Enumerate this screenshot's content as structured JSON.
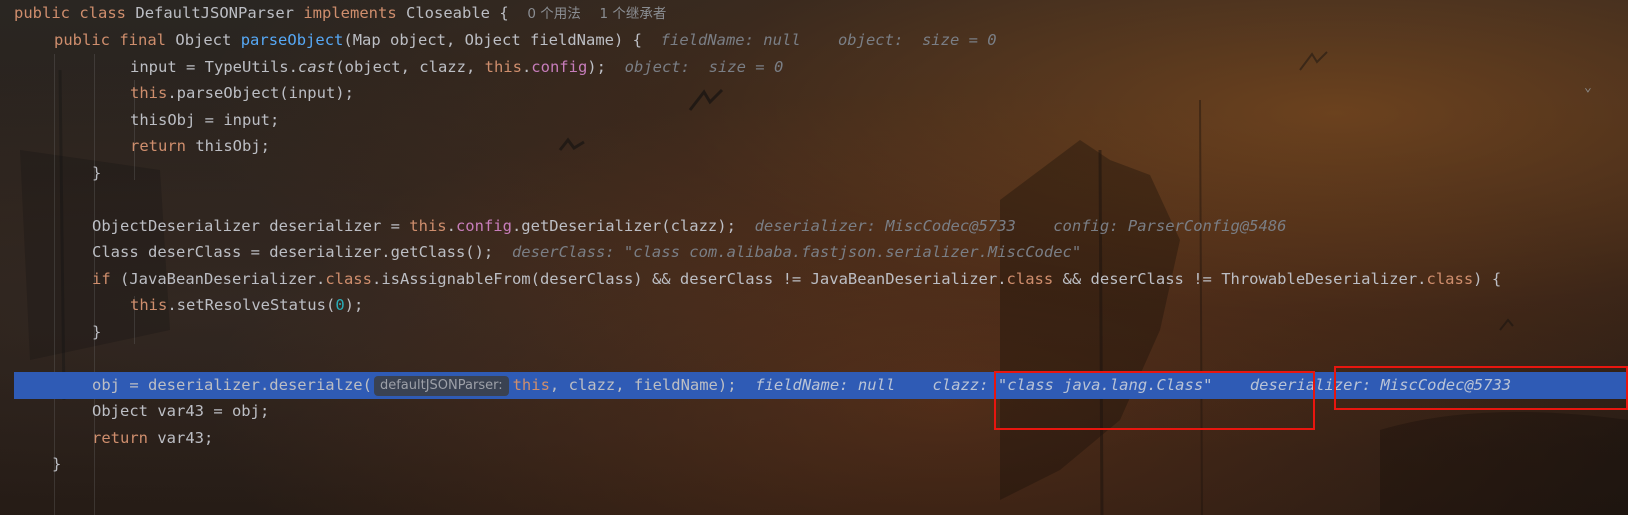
{
  "line1": {
    "kw1": "public",
    "kw2": "class",
    "class_name": "DefaultJSONParser",
    "kw3": "implements",
    "iface": "Closeable",
    "brace": "{",
    "usages": "0 个用法",
    "inheritors": "1 个继承者"
  },
  "line2": {
    "kw1": "public",
    "kw2": "final",
    "t1": "Object",
    "method": "parseObject",
    "params": "(Map object, Object fieldName) {",
    "hint1": "fieldName: null",
    "hint2": "object:  size = 0"
  },
  "line3": {
    "a": "input = TypeUtils.",
    "b": "cast",
    "c": "(object, clazz, ",
    "kw": "this",
    "d": ".",
    "fld": "config",
    "e": ");",
    "hint": "object:  size = 0"
  },
  "line4": {
    "kw": "this",
    "rest": ".parseObject(input);"
  },
  "line5": {
    "text": "thisObj = input;"
  },
  "line6": {
    "kw": "return",
    "rest": " thisObj;"
  },
  "line7": {
    "text": "}"
  },
  "line9": {
    "a": "ObjectDeserializer deserializer = ",
    "kw": "this",
    "b": ".",
    "fld": "config",
    "c": ".getDeserializer(clazz);",
    "hint1": "deserializer: MiscCodec@5733",
    "hint2": "config: ParserConfig@5486"
  },
  "line10": {
    "a": "Class deserClass = deserializer.getClass();",
    "hint": "deserClass: \"class com.alibaba.fastjson.serializer.MiscCodec\""
  },
  "line11": {
    "kw1": "if",
    "a": " (JavaBeanDeserializer.",
    "kw2": "class",
    "b": ".isAssignableFrom(deserClass) && deserClass != JavaBeanDeserializer.",
    "kw3": "class",
    "c": " && deserClass != ThrowableDeserializer.",
    "kw4": "class",
    "d": ") {"
  },
  "line12": {
    "kw": "this",
    "a": ".setResolveStatus(",
    "num": "0",
    "b": ");"
  },
  "line13": {
    "text": "}"
  },
  "line15": {
    "a": "obj = deserializer.deserialze(",
    "param_hint": "defaultJSONParser:",
    "kw": "this",
    "b": ", clazz, fieldName);",
    "hint1": "fieldName: null",
    "hint2": "clazz: \"class java.lang.Class\"",
    "hint3": "deserializer: MiscCodec@5733"
  },
  "line16": {
    "text": "Object var43 = obj;"
  },
  "line17": {
    "kw": "return",
    "rest": " var43;"
  },
  "line18": {
    "text": "}"
  },
  "colors": {
    "keyword": "#cf8e6d",
    "field": "#c77dbb",
    "method": "#56a8f5",
    "number": "#2aacb8",
    "hint": "#7a7e85",
    "execution_line": "#2f5bb5",
    "highlight_box": "#e8160f"
  }
}
